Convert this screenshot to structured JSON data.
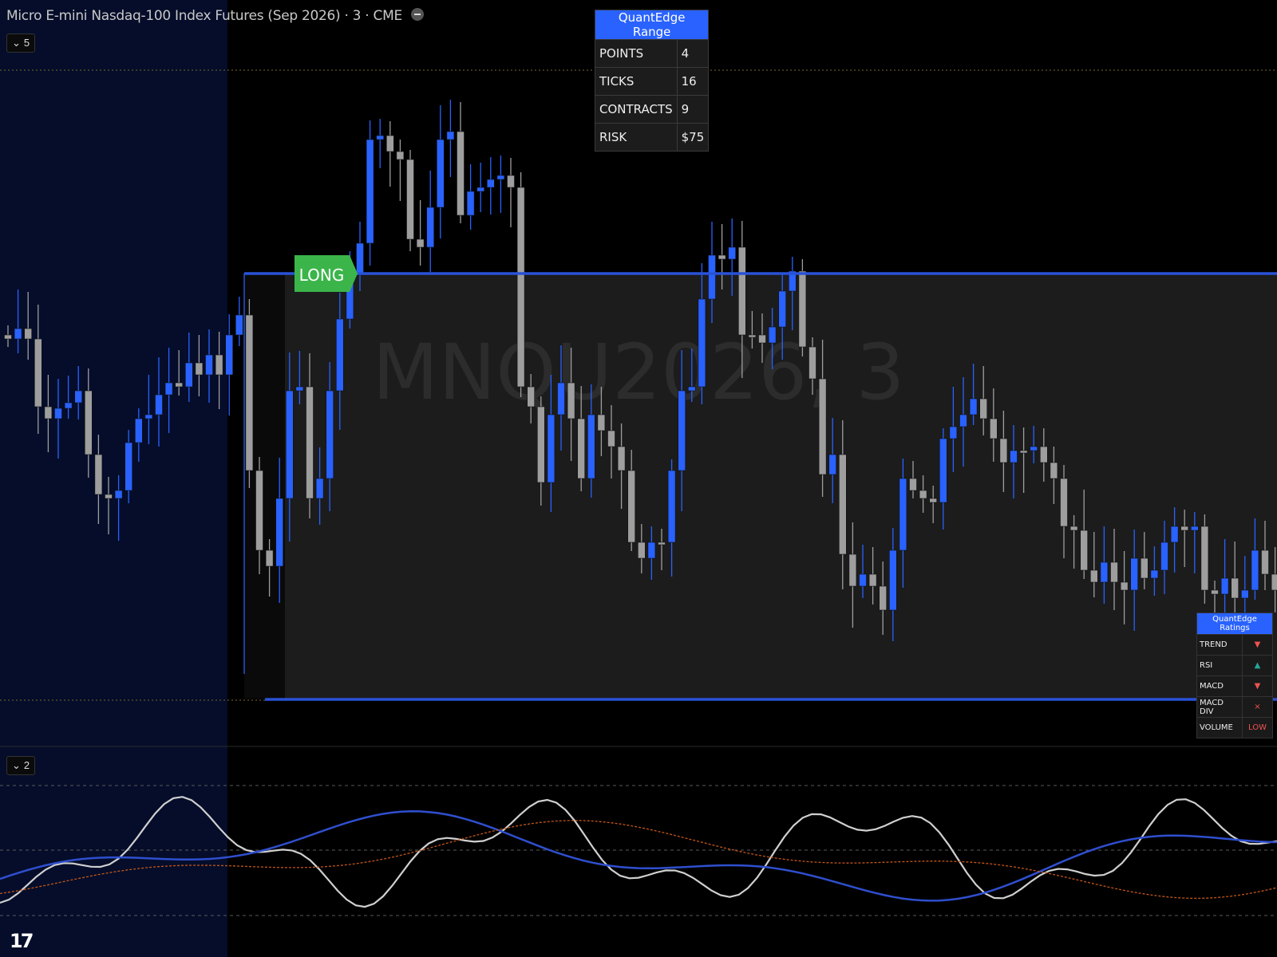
{
  "header": {
    "title": "Micro E-mini Nasdaq-100 Index Futures (Sep 2026) · 3 · CME",
    "main_pane_count": "5",
    "osc_pane_count": "2"
  },
  "watermark": "MNQU2026, 3",
  "signal": {
    "label": "LONG",
    "color": "#3bb54a"
  },
  "range_table": {
    "title": "QuantEdge Range",
    "rows": [
      {
        "label": "POINTS",
        "value": "4"
      },
      {
        "label": "TICKS",
        "value": "16"
      },
      {
        "label": "CONTRACTS",
        "value": "9"
      },
      {
        "label": "RISK",
        "value": "$75"
      }
    ]
  },
  "ratings_table": {
    "title": "QuantEdge Ratings",
    "rows": [
      {
        "label": "TREND",
        "value": "▼",
        "color": "#ef5350"
      },
      {
        "label": "RSI",
        "value": "▲",
        "color": "#26a69a"
      },
      {
        "label": "MACD",
        "value": "▼",
        "color": "#ef5350"
      },
      {
        "label": "MACD DIV",
        "value": "×",
        "color": "#ef5350"
      },
      {
        "label": "VOLUME",
        "value": "LOW",
        "color": "#ef5350"
      }
    ]
  },
  "colors": {
    "bull": "#2962ff",
    "bear": "#9e9e9e",
    "zone": "#1c1c1c",
    "session": "#050d2a",
    "range_line": "#2952d6",
    "osc_white": "#d0d0d0",
    "osc_blue": "#2f4fcf",
    "osc_orange": "#c2571a"
  },
  "logo": "17"
}
